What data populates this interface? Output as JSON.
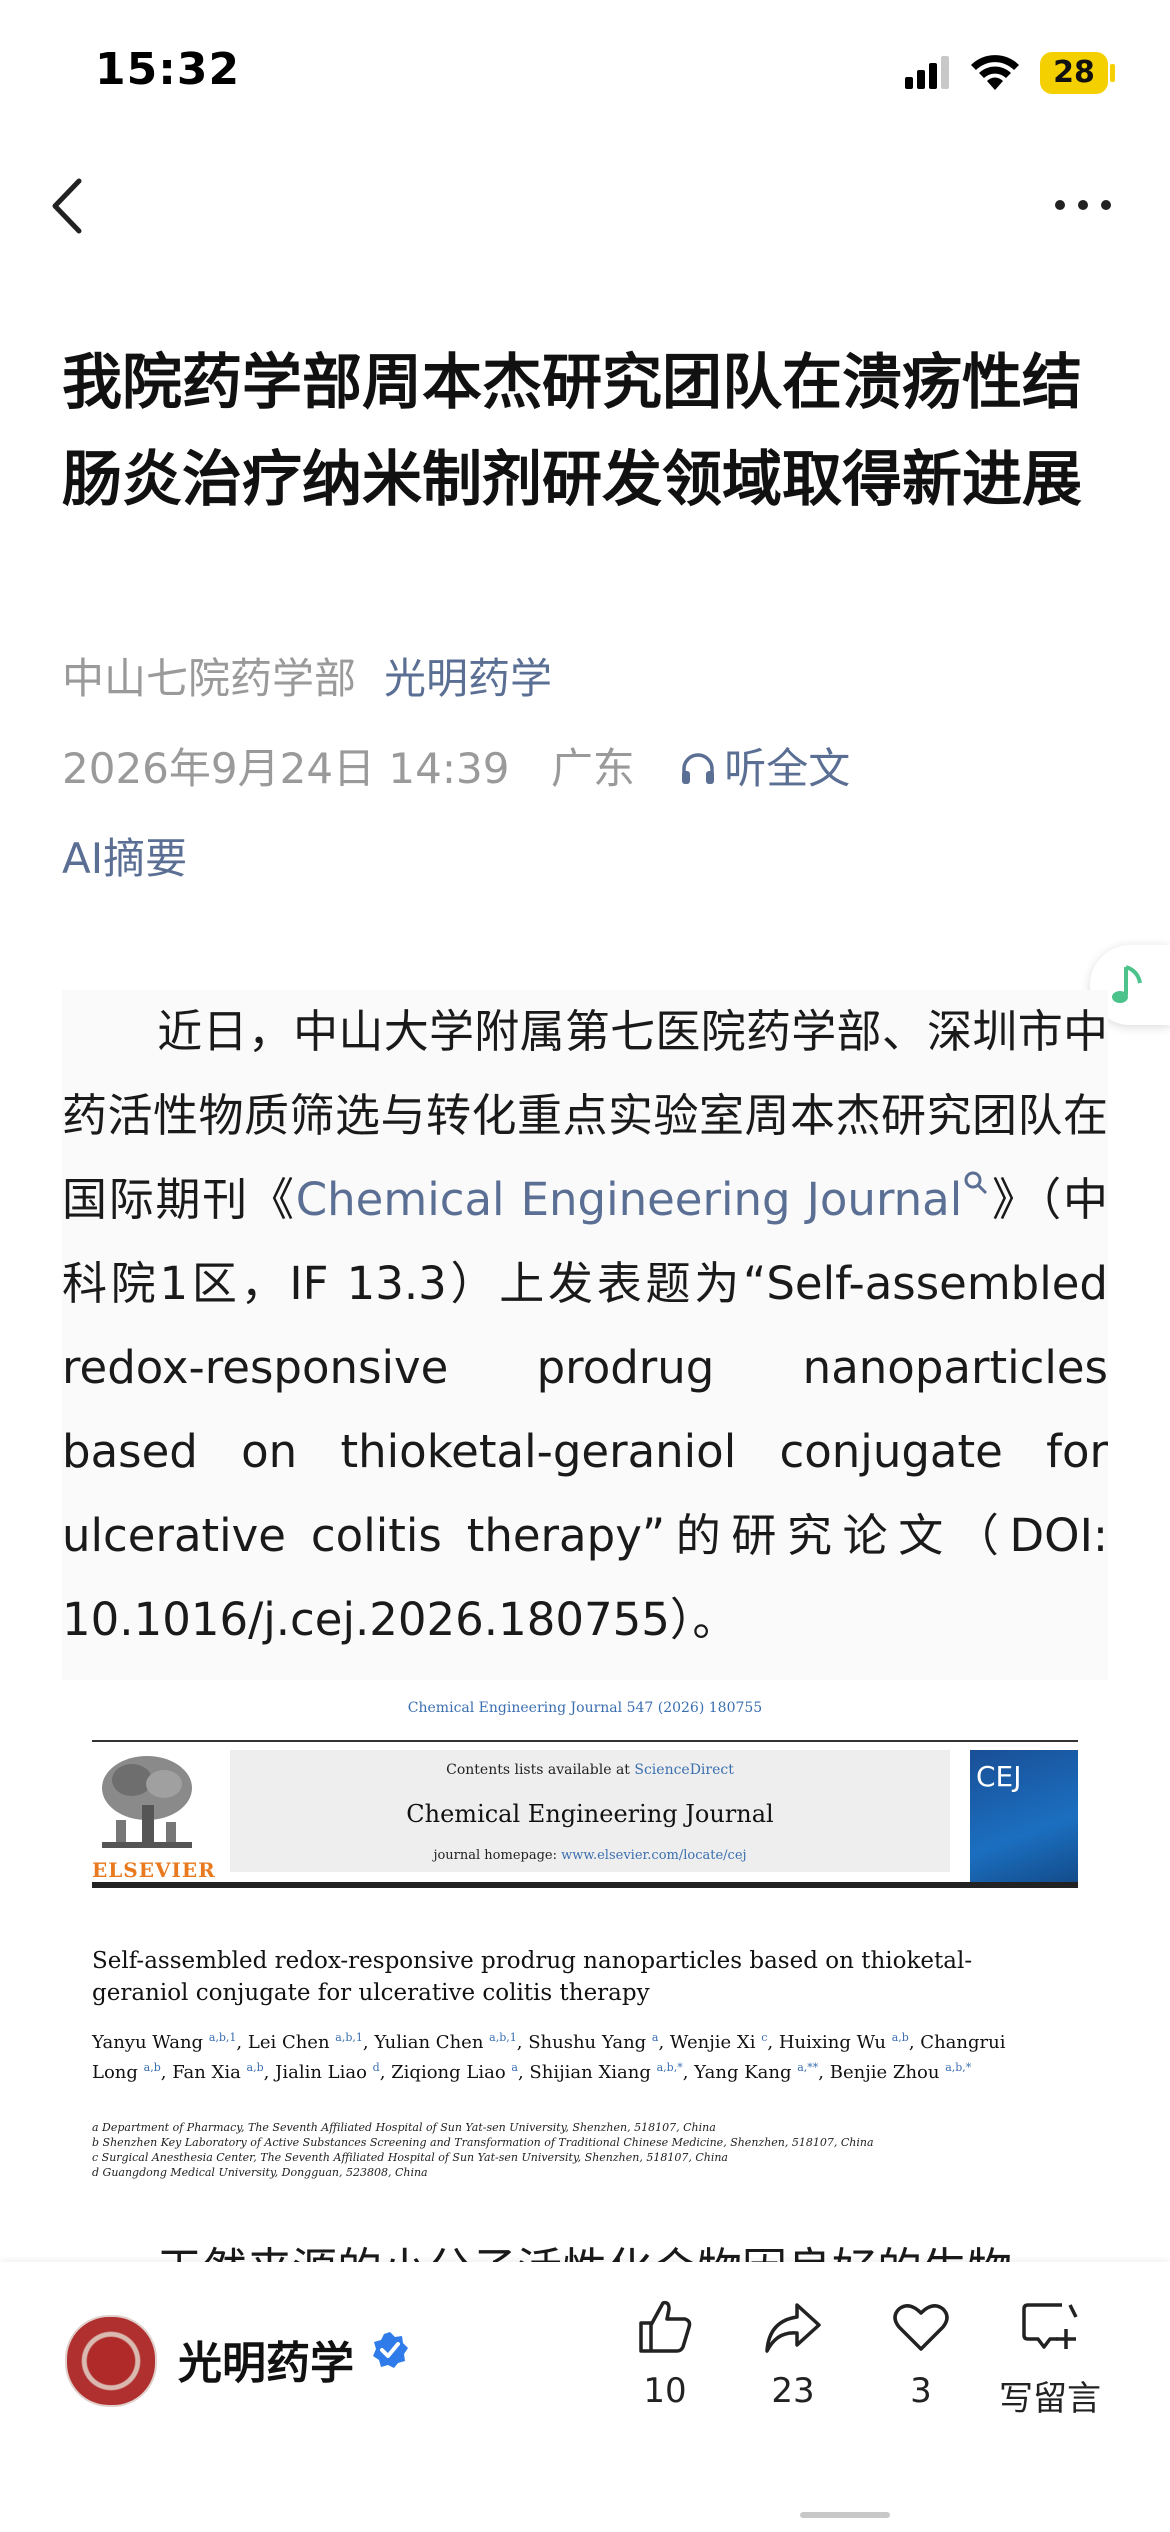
{
  "status_bar": {
    "time": "15:32",
    "battery": "28"
  },
  "article": {
    "title": "我院药学部周本杰研究团队在溃疡性结肠炎治疗纳米制剂研发领域取得新进展",
    "source": "中山七院药学部",
    "account": "光明药学",
    "date": "2026年9月24日 14:39",
    "location": "广东",
    "listen_label": "听全文",
    "ai_summary_label": "AI摘要",
    "body": {
      "p1_before_link": "近日，中山大学附属第七医院药学部、深圳市中药活性物质筛选与转化重点实验室周本杰研究团队在国际期刊《",
      "journal_link": "Chemical Engineering Journal",
      "p1_after_link": "》（中科院1区，IF 13.3）上发表题为“Self-assembled redox-responsive prodrug nanoparticles based on thioketal-geraniol conjugate for ulcerative colitis therapy”的研究论文（DOI: 10.1016/j.cej.2026.180755）。",
      "p2_partial": "天然来源的小分子活性化合物因良好的生物"
    },
    "paper_image": {
      "journal_ref": "Chemical Engineering Journal 547 (2026) 180755",
      "contents_prefix": "Contents lists available at ",
      "contents_link": "ScienceDirect",
      "journal_name": "Chemical Engineering Journal",
      "homepage_prefix": "journal homepage: ",
      "homepage_link": "www.elsevier.com/locate/cej",
      "publisher": "ELSEVIER",
      "cover_text": "CEJ",
      "paper_title": "Self-assembled redox-responsive prodrug nanoparticles based on thioketal-geraniol conjugate for ulcerative colitis therapy",
      "authors": [
        {
          "name": "Yanyu Wang",
          "sup": "a,b,1"
        },
        {
          "name": "Lei Chen",
          "sup": "a,b,1"
        },
        {
          "name": "Yulian Chen",
          "sup": "a,b,1"
        },
        {
          "name": "Shushu Yang",
          "sup": "a"
        },
        {
          "name": "Wenjie Xi",
          "sup": "c"
        },
        {
          "name": "Huixing Wu",
          "sup": "a,b"
        },
        {
          "name": "Changrui Long",
          "sup": "a,b"
        },
        {
          "name": "Fan Xia",
          "sup": "a,b"
        },
        {
          "name": "Jialin Liao",
          "sup": "d"
        },
        {
          "name": "Ziqiong Liao",
          "sup": "a"
        },
        {
          "name": "Shijian Xiang",
          "sup": "a,b,*"
        },
        {
          "name": "Yang Kang",
          "sup": "a,**"
        },
        {
          "name": "Benjie Zhou",
          "sup": "a,b,*"
        }
      ],
      "affiliations": [
        "a Department of Pharmacy, The Seventh Affiliated Hospital of Sun Yat-sen University, Shenzhen, 518107, China",
        "b Shenzhen Key Laboratory of Active Substances Screening and Transformation of Traditional Chinese Medicine, Shenzhen, 518107, China",
        "c Surgical Anesthesia Center, The Seventh Affiliated Hospital of Sun Yat-sen University, Shenzhen, 518107, China",
        "d Guangdong Medical University, Dongguan, 523808, China"
      ]
    }
  },
  "bottom_bar": {
    "account_name": "光明药学",
    "like_count": "10",
    "share_count": "23",
    "favorite_count": "3",
    "comment_label": "写留言"
  },
  "colors": {
    "accent": "#5a6f93",
    "battery": "#f5d000",
    "verified": "#2f7bea",
    "music": "#4cc38a"
  }
}
